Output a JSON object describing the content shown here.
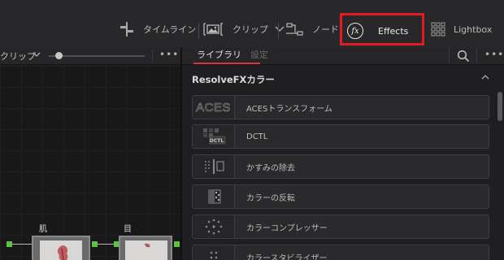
{
  "toolbar": {
    "timeline_label": "タイムライン",
    "clip_label": "クリップ",
    "node_label": "ノード",
    "effects_label": "Effects",
    "effects_icon_text": "fx",
    "lightbox_label": "Lightbox",
    "highlight_color": "#e01b22"
  },
  "node_panel": {
    "clip_selector": "クリップ",
    "node1_label": "肌",
    "node2_label": "目"
  },
  "effects_panel": {
    "tab_library": "ライブラリ",
    "tab_settings": "設定",
    "category_title": "ResolveFXカラー",
    "aces_logo_text": "ACES",
    "dctl_badge_text": "DCTL",
    "items": [
      {
        "label": "ACESトランスフォーム",
        "icon": "aces-logo-icon"
      },
      {
        "label": "DCTL",
        "icon": "dctl-icon"
      },
      {
        "label": "かすみの除去",
        "icon": "dehaze-icon"
      },
      {
        "label": "カラーの反転",
        "icon": "invert-color-icon"
      },
      {
        "label": "カラーコンプレッサー",
        "icon": "color-compressor-icon"
      },
      {
        "label": "カラースタビライザー",
        "icon": "color-stabilizer-icon"
      }
    ],
    "accent_color": "#e0323a"
  }
}
